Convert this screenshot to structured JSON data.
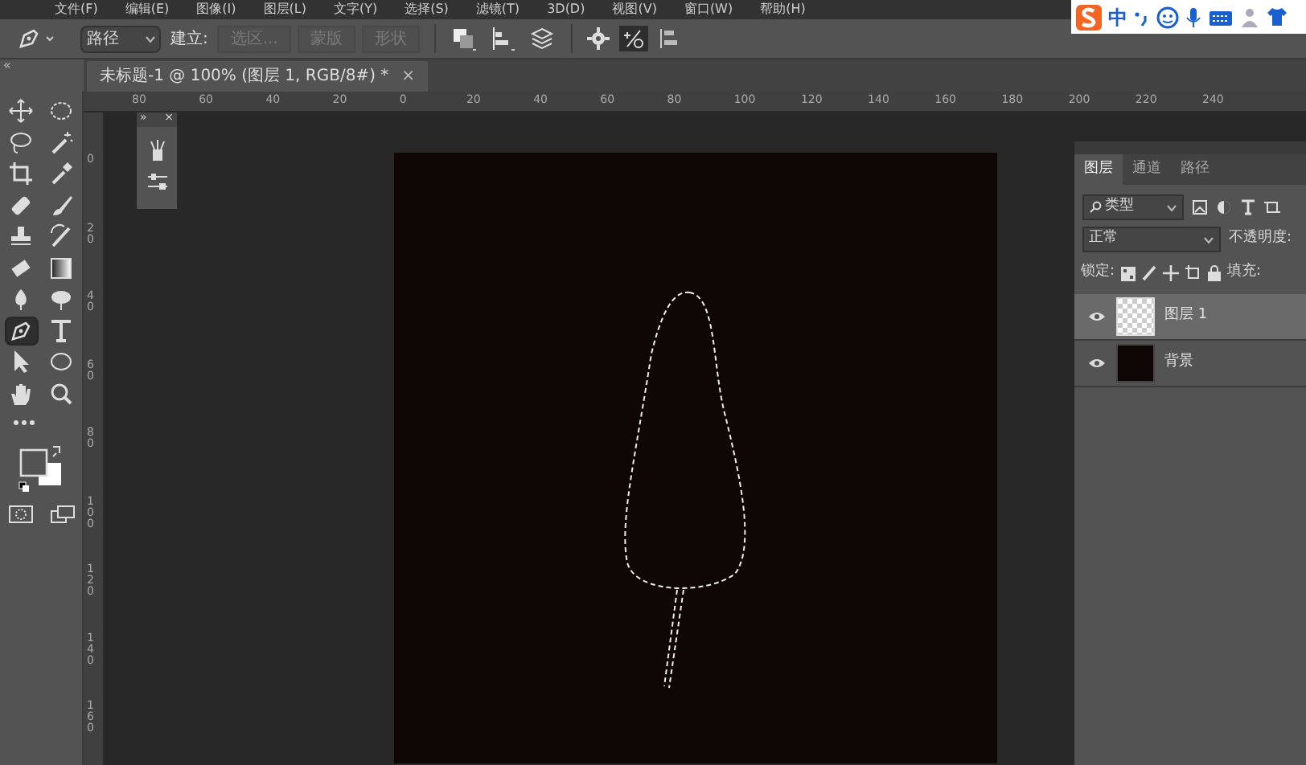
{
  "menu": [
    "文件(F)",
    "编辑(E)",
    "图像(I)",
    "图层(L)",
    "文字(Y)",
    "选择(S)",
    "滤镜(T)",
    "3D(D)",
    "视图(V)",
    "窗口(W)",
    "帮助(H)"
  ],
  "ime_bar": {
    "label": "中"
  },
  "options_bar": {
    "mode": "路径",
    "make_label": "建立:",
    "buttons": [
      {
        "label": "选区...",
        "disabled": true
      },
      {
        "label": "蒙版",
        "disabled": true
      },
      {
        "label": "形状",
        "disabled": true
      }
    ]
  },
  "document_tab": {
    "title": "未标题-1 @ 100% (图层 1, RGB/8#) *",
    "close": "×"
  },
  "toolbar_collapse": "«",
  "rulers": {
    "horizontal": [
      "80",
      "60",
      "40",
      "20",
      "0",
      "20",
      "40",
      "60",
      "80",
      "100",
      "120",
      "140",
      "160",
      "180",
      "200",
      "220",
      "240"
    ],
    "vertical": [
      "0",
      "20",
      "40",
      "60",
      "80",
      "100",
      "120",
      "140",
      "160"
    ]
  },
  "mini_panel": {
    "expand": "»",
    "close": "×"
  },
  "tools": [
    {
      "selected": false
    },
    {
      "selected": false
    },
    {
      "selected": false
    },
    {
      "selected": false
    },
    {
      "selected": false
    },
    {
      "selected": false
    },
    {
      "selected": false
    },
    {
      "selected": false
    },
    {
      "selected": false
    },
    {
      "selected": false
    },
    {
      "selected": false
    },
    {
      "selected": false
    },
    {
      "selected": false
    },
    {
      "selected": false
    },
    {
      "selected": true
    },
    {
      "selected": false
    },
    {
      "selected": false
    },
    {
      "selected": false
    },
    {
      "selected": false
    },
    {
      "selected": false
    }
  ],
  "layers_panel": {
    "tabs": [
      {
        "label": "图层",
        "selected": true
      },
      {
        "label": "通道",
        "selected": false
      },
      {
        "label": "路径",
        "selected": false
      }
    ],
    "filter": "类型",
    "blend_mode": "正常",
    "opacity_label": "不透明度:",
    "lock_label": "锁定:",
    "fill_label": "填充:",
    "layers": [
      {
        "name": "图层 1",
        "visible": true,
        "selected": true,
        "kind": "transparent"
      },
      {
        "name": "背景",
        "visible": true,
        "selected": false,
        "kind": "fill"
      }
    ]
  }
}
